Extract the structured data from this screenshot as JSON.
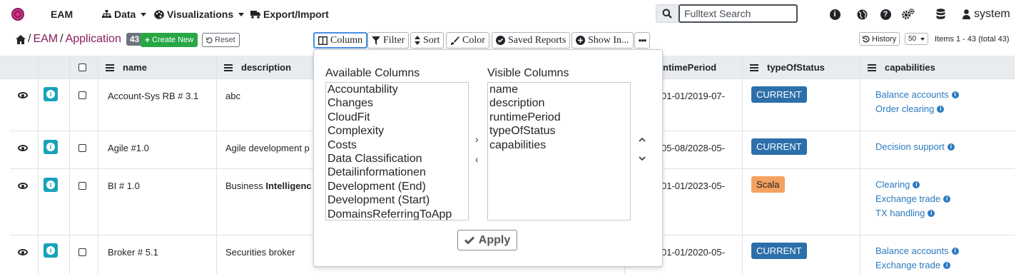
{
  "navbar": {
    "brand": "EAM",
    "menus": [
      {
        "label": "Data",
        "icon": "sitemap-icon"
      },
      {
        "label": "Visualizations",
        "icon": "palette-icon"
      },
      {
        "label": "Export/Import",
        "icon": "truck-icon"
      }
    ],
    "search": {
      "placeholder": "Fulltext Search",
      "value": ""
    },
    "user": "system"
  },
  "toolbar": {
    "breadcrumb": [
      "EAM",
      "Application"
    ],
    "count": "43",
    "create_label": "Create New",
    "reset_label": "Reset",
    "buttons": [
      "Column",
      "Filter",
      "Sort",
      "Color",
      "Saved Reports",
      "Show In...",
      "..."
    ],
    "history_label": "History",
    "page_size": "50",
    "items_info": "Items 1 - 43 (total 43)"
  },
  "table": {
    "columns": [
      "name",
      "description",
      "runtimePeriod",
      "typeOfStatus",
      "capabilities"
    ],
    "runtime_header_visible": "ntimePeriod",
    "rows": [
      {
        "name": "Account-Sys RB # 3.1",
        "description": "abc",
        "runtime": "01-01/2019-07-",
        "status": "CURRENT",
        "capabilities": [
          "Balance accounts",
          "Order clearing"
        ]
      },
      {
        "name": "Agile #1.0",
        "description": "Agile development p",
        "runtime": "05-08/2028-05-",
        "status": "CURRENT",
        "capabilities": [
          "Decision support"
        ]
      },
      {
        "name": "BI # 1.0",
        "description_prefix": "Business ",
        "description_bold": "Intelligenc",
        "runtime": "01-01/2023-05-",
        "status": "Scala",
        "capabilities": [
          "Clearing",
          "Exchange trade",
          "TX handling"
        ]
      },
      {
        "name": "Broker # 5.1",
        "description": "Securities broker",
        "runtime": "01-01/2020-05-",
        "status": "CURRENT",
        "capabilities": [
          "Balance accounts",
          "Exchange trade"
        ]
      }
    ]
  },
  "column_popup": {
    "available_label": "Available Columns",
    "visible_label": "Visible Columns",
    "available": [
      "Accountability",
      "Changes",
      "CloudFit",
      "Complexity",
      "Costs",
      "Data Classification",
      "Detailinformationen",
      "Development (End)",
      "Development (Start)",
      "DomainsReferringToApp"
    ],
    "visible": [
      "name",
      "description",
      "runtimePeriod",
      "typeOfStatus",
      "capabilities"
    ],
    "apply_label": "Apply"
  },
  "colors": {
    "brand": "#8a1a5c",
    "create": "#28a745",
    "current": "#2c6faa",
    "scala": "#f4a261",
    "link": "#2a7ac0",
    "info": "#17a2b8"
  }
}
